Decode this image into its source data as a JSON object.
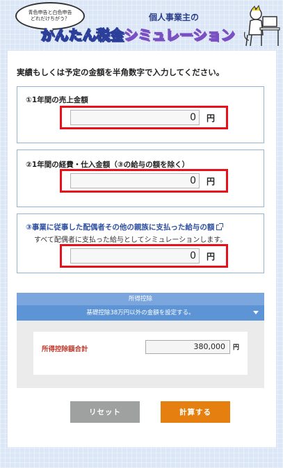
{
  "header": {
    "bubble_line1": "青色申告と白色申告",
    "bubble_line2": "どれだけちがう？",
    "subtitle": "個人事業主の",
    "title_part1": "かんたん",
    "title_part2": "税金",
    "title_part3": "シミュレーション"
  },
  "instruction": "実績もしくは予定の金額を半角数字で入力してください。",
  "fields": [
    {
      "label": "①1年間の売上金額",
      "value": "0",
      "unit": "円"
    },
    {
      "label": "②1年間の経費・仕入金額（③の給与の額を除く）",
      "value": "0",
      "unit": "円"
    },
    {
      "label": "③事業に従事した配偶者その他の親族に支払った給与の額",
      "note": "すべて配偶者に支払った給与としてシミュレーションします。",
      "value": "0",
      "unit": "円"
    }
  ],
  "deduction": {
    "header": "所得控除",
    "toggle": "基礎控除38万円以外の金額を設定する。",
    "total_label": "所得控除額合計",
    "total_value": "380,000",
    "unit": "円"
  },
  "buttons": {
    "reset": "リセット",
    "calculate": "計算する"
  },
  "colors": {
    "highlight_border": "#e8101a",
    "deduction_header": "#7aa6dd",
    "deduction_bar": "#5c94d6",
    "reset_button": "#9fa0a0",
    "calculate_button": "#e57f10"
  }
}
